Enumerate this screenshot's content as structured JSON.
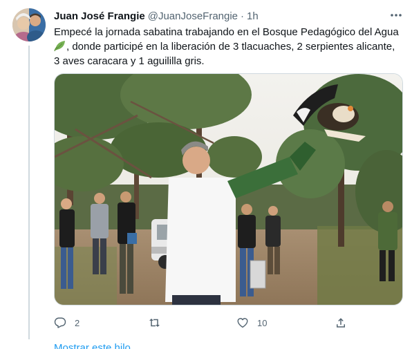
{
  "tweet": {
    "display_name": "Juan José Frangie",
    "handle": "@JuanJoseFrangie",
    "separator": "·",
    "time": "1h",
    "text_line1": "Empecé la jornada sabatina trabajando en el Bosque Pedagógico del Agua",
    "text_line2": ", donde participé en la liberación de 3 tlacuaches, 2 serpientes alicante,",
    "text_line3": "3 aves caracara y 1 aguililla gris.",
    "emoji": "leaf-emoji",
    "media": "photo of a man in a white shirt releasing a caracara bird among pine trees, volunteers photographing behind"
  },
  "actions": {
    "reply_count": "2",
    "retweet_count": "",
    "like_count": "10"
  },
  "show_thread_label": "Mostrar este hilo",
  "colors": {
    "text": "#0f1419",
    "secondary": "#536471",
    "accent": "#1d9bf0",
    "border": "#cfd9de"
  },
  "icons": [
    "more-icon",
    "reply-icon",
    "retweet-icon",
    "like-icon",
    "share-icon",
    "leaf-emoji"
  ]
}
